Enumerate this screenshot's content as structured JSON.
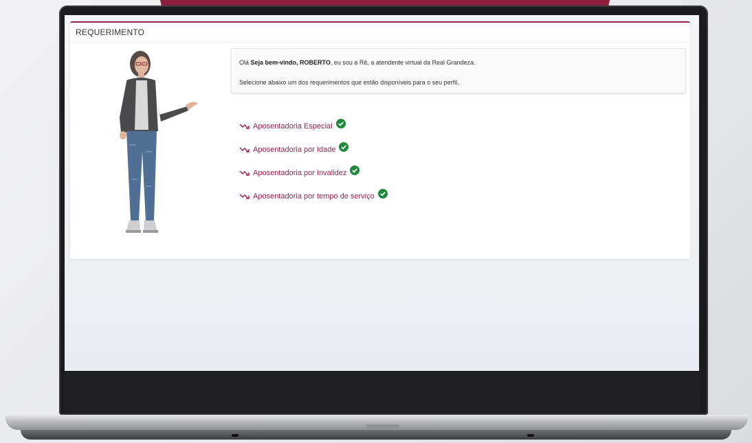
{
  "card": {
    "title": "REQUERIMENTO"
  },
  "message": {
    "greeting_prefix": "Olá ",
    "greeting_bold": "Seja bem-vindo, ROBERTO",
    "greeting_suffix": ", eu sou a Rê, a atendente virtual da Real Grandeza.",
    "instruction": "Selecione abaixo um dos requerimentos que estão disponíveis para o seu perfil."
  },
  "requirements": [
    {
      "label": "Aposentadoria Especial",
      "status_icon": "check-circle-icon"
    },
    {
      "label": "Aposentadoria por Idade",
      "status_icon": "check-circle-icon"
    },
    {
      "label": "Aposentadoria por Invalidez",
      "status_icon": "check-circle-icon"
    },
    {
      "label": "Aposentadoria por tempo de serviço",
      "status_icon": "check-circle-icon"
    }
  ],
  "colors": {
    "accent": "#9b2247",
    "check": "#1f8a3a",
    "laptop_frame": "#1c1c1e"
  }
}
